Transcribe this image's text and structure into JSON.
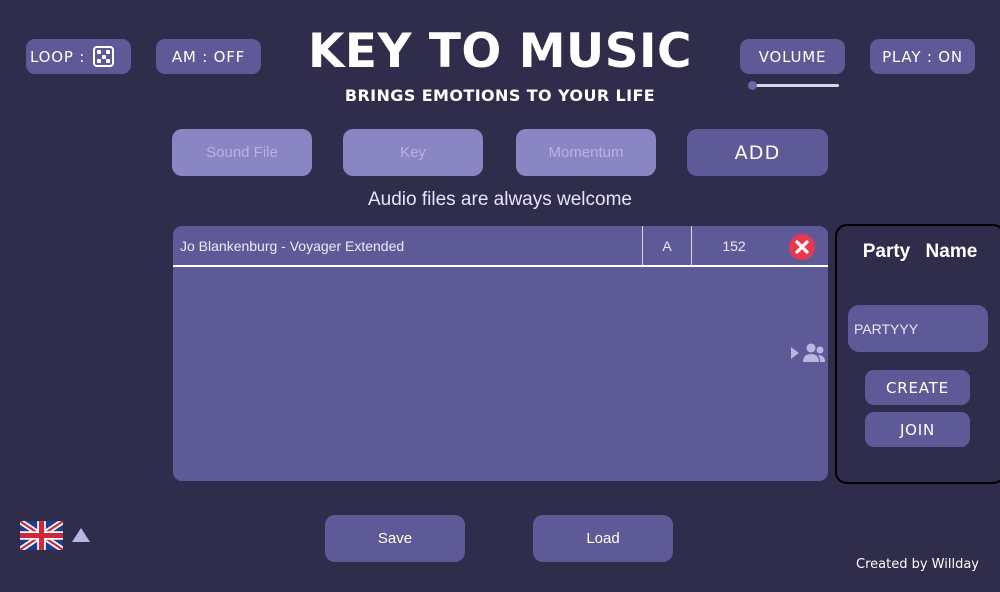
{
  "header": {
    "title": "KEY TO MUSIC",
    "subtitle": "BRINGS EMOTIONS TO YOUR LIFE"
  },
  "controls": {
    "loop_label": "LOOP :",
    "loop_icon": "dice-icon",
    "am_label": "AM : OFF",
    "volume_label": "VOLUME",
    "volume_level": 0.0,
    "play_label": "PLAY : ON"
  },
  "add_form": {
    "sound_file_placeholder": "Sound File",
    "key_placeholder": "Key",
    "momentum_placeholder": "Momentum",
    "add_label": "ADD"
  },
  "welcome_text": "Audio files are always welcome",
  "tracks": [
    {
      "name": "Jo Blankenburg - Voyager Extended",
      "key": "A",
      "bpm": "152"
    }
  ],
  "party": {
    "title": "Party Name",
    "input_value": "PARTYYY",
    "create_label": "CREATE",
    "join_label": "JOIN"
  },
  "footer": {
    "save_label": "Save",
    "load_label": "Load",
    "language_icon": "uk-flag-icon",
    "credit": "Created by Willday"
  },
  "colors": {
    "background": "#2f2c4c",
    "button": "#5e5a98",
    "field": "#8a86c3",
    "remove": "#e63950"
  }
}
